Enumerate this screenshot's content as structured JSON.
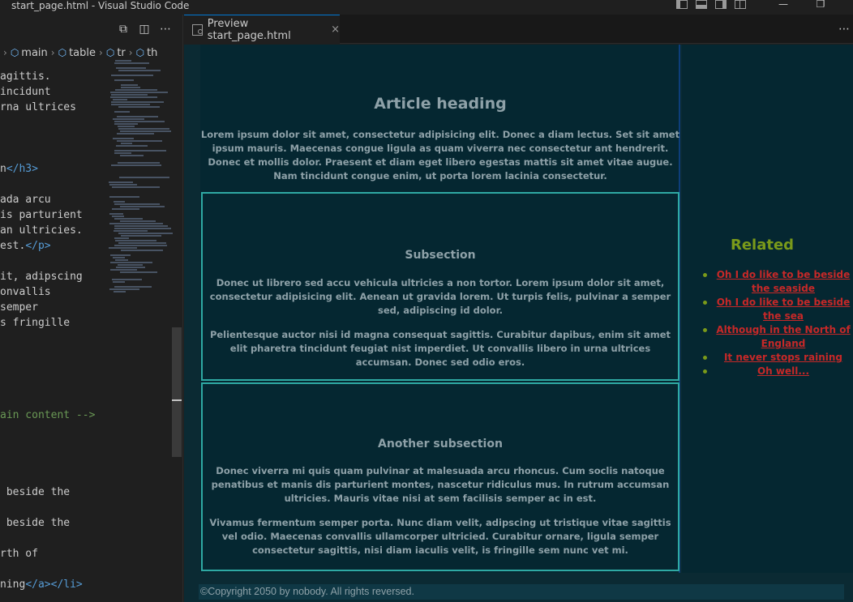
{
  "window": {
    "title": "start_page.html - Visual Studio Code"
  },
  "editor": {
    "breadcrumb": [
      "main",
      "table",
      "tr",
      "th"
    ],
    "code_lines": [
      {
        "text": "agittis."
      },
      {
        "text": "incidunt"
      },
      {
        "text": "rna ultrices"
      },
      {
        "text": ""
      },
      {
        "text": ""
      },
      {
        "text": ""
      },
      {
        "text": "n</h3>"
      },
      {
        "text": ""
      },
      {
        "text": "ada arcu"
      },
      {
        "text": "is parturient"
      },
      {
        "text": "an ultricies."
      },
      {
        "text": "est.</p>"
      },
      {
        "text": ""
      },
      {
        "text": "it, adipscing"
      },
      {
        "text": "onvallis"
      },
      {
        "text": "semper"
      },
      {
        "text": "s fringille"
      },
      {
        "text": ""
      },
      {
        "text": ""
      },
      {
        "text": ""
      },
      {
        "text": ""
      },
      {
        "text": ""
      },
      {
        "text": "ain content -->"
      },
      {
        "text": ""
      },
      {
        "text": ""
      },
      {
        "text": ""
      },
      {
        "text": ""
      },
      {
        "text": " beside the"
      },
      {
        "text": ""
      },
      {
        "text": " beside the"
      },
      {
        "text": ""
      },
      {
        "text": "rth of"
      },
      {
        "text": ""
      },
      {
        "text": "ning</a></li>"
      }
    ]
  },
  "tab": {
    "label": "Preview start_page.html",
    "close": "×"
  },
  "preview": {
    "article_heading": "Article heading",
    "article_lead": "Lorem ipsum dolor sit amet, consectetur adipisicing elit. Donec a diam lectus. Set sit amet ipsum mauris. Maecenas congue ligula as quam viverra nec consectetur ant hendrerit. Donec et mollis dolor. Praesent et diam eget libero egestas mattis sit amet vitae augue. Nam tincidunt congue enim, ut porta lorem lacinia consectetur.",
    "subsection1": {
      "heading": "Subsection",
      "p1": "Donec ut librero sed accu vehicula ultricies a non tortor. Lorem ipsum dolor sit amet, consectetur adipisicing elit. Aenean ut gravida lorem. Ut turpis felis, pulvinar a semper sed, adipiscing id dolor.",
      "p2": "Pelientesque auctor nisi id magna consequat sagittis. Curabitur dapibus, enim sit amet elit pharetra tincidunt feugiat nist imperdiet. Ut convallis libero in urna ultrices accumsan. Donec sed odio eros."
    },
    "subsection2": {
      "heading": "Another subsection",
      "p1": "Donec viverra mi quis quam pulvinar at malesuada arcu rhoncus. Cum soclis natoque penatibus et manis dis parturient montes, nascetur ridiculus mus. In rutrum accumsan ultricies. Mauris vitae nisi at sem facilisis semper ac in est.",
      "p2": "Vivamus fermentum semper porta. Nunc diam velit, adipscing ut tristique vitae sagittis vel odio. Maecenas convallis ullamcorper ultricied. Curabitur ornare, ligula semper consectetur sagittis, nisi diam iaculis velit, is fringille sem nunc vet mi."
    },
    "related": {
      "heading": "Related",
      "links": [
        "Oh I do like to be beside the seaside",
        "Oh I do like to be beside the sea",
        "Although in the North of England",
        "It never stops raining",
        "Oh well..."
      ]
    },
    "footer": "©Copyright 2050 by nobody. All rights reversed."
  },
  "colors": {
    "preview_bg": "#052731",
    "border_teal": "#2fa9a3",
    "related_green": "#7a9a1a",
    "link_red": "#c62828"
  }
}
